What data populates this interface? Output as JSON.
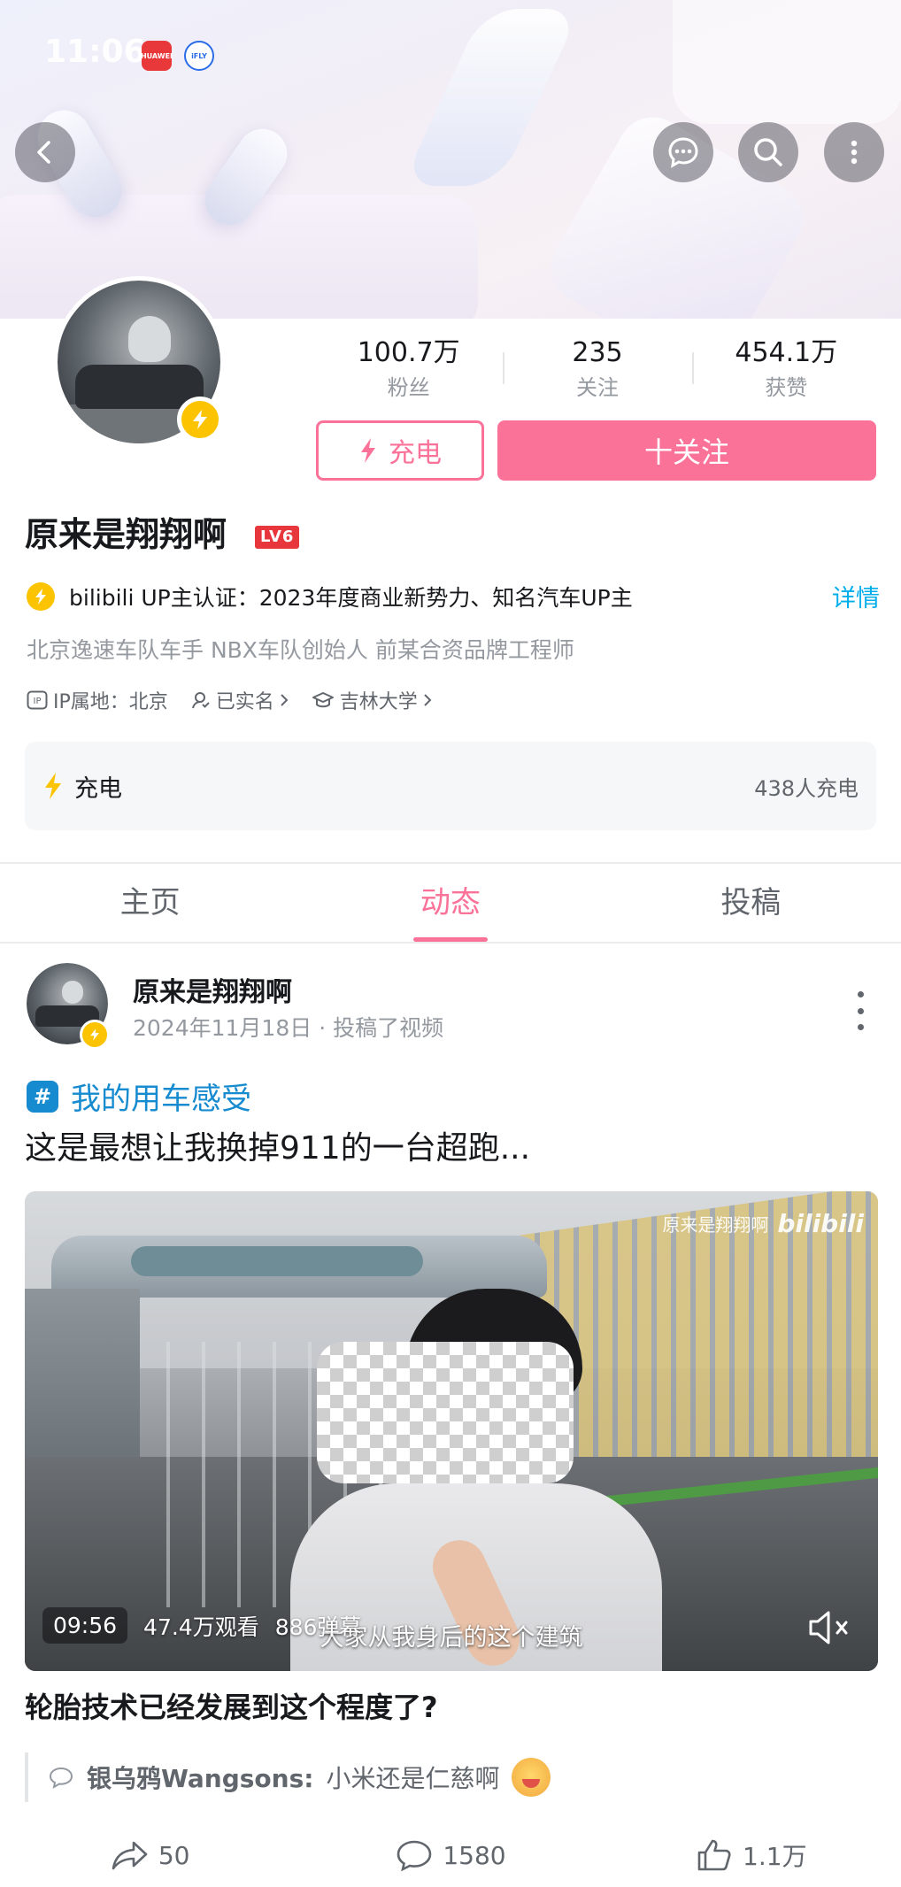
{
  "status_bar": {
    "time": "11:06",
    "badge_huawei": "HUAWEI",
    "badge_ifly": "iFLY"
  },
  "stats": [
    {
      "value": "100.7万",
      "label": "粉丝"
    },
    {
      "value": "235",
      "label": "关注"
    },
    {
      "value": "454.1万",
      "label": "获赞"
    }
  ],
  "actions": {
    "charge_label": "充电",
    "follow_label": "十关注"
  },
  "profile": {
    "name": "原来是翔翔啊",
    "level": "LV6",
    "certification": "bilibili UP主认证：2023年度商业新势力、知名汽车UP主",
    "detail_link": "详情",
    "bio": "北京逸速车队车手 NBX车队创始人 前某合资品牌工程师",
    "ip_location": "IP属地：北京",
    "real_name": "已实名",
    "school": "吉林大学"
  },
  "charge_panel": {
    "label": "充电",
    "count": "438人充电"
  },
  "tabs": [
    {
      "label": "主页",
      "active": false
    },
    {
      "label": "动态",
      "active": true
    },
    {
      "label": "投稿",
      "active": false
    }
  ],
  "post": {
    "author": "原来是翔翔啊",
    "meta": "2024年11月18日 · 投稿了视频",
    "topic": "我的用车感受",
    "text": "这是最想让我换掉911的一台超跑...",
    "video": {
      "watermark_name": "原来是翔翔啊",
      "watermark_logo": "bilibili",
      "duration": "09:56",
      "views": "47.4万观看",
      "danmaku": "886弹幕",
      "subtitle": "大家从我身后的这个建筑",
      "title": "轮胎技术已经发展到这个程度了?"
    },
    "comment": {
      "user": "银乌鸦Wangsons:",
      "text": "小米还是仁慈啊"
    },
    "share_count": "50",
    "comment_count": "1580",
    "like_count": "1.1万"
  },
  "colors": {
    "accent": "#fb7299",
    "link": "#00aeec",
    "topic": "#178bcf",
    "badge_yellow": "#fbc300",
    "level_red": "#e8373c"
  }
}
